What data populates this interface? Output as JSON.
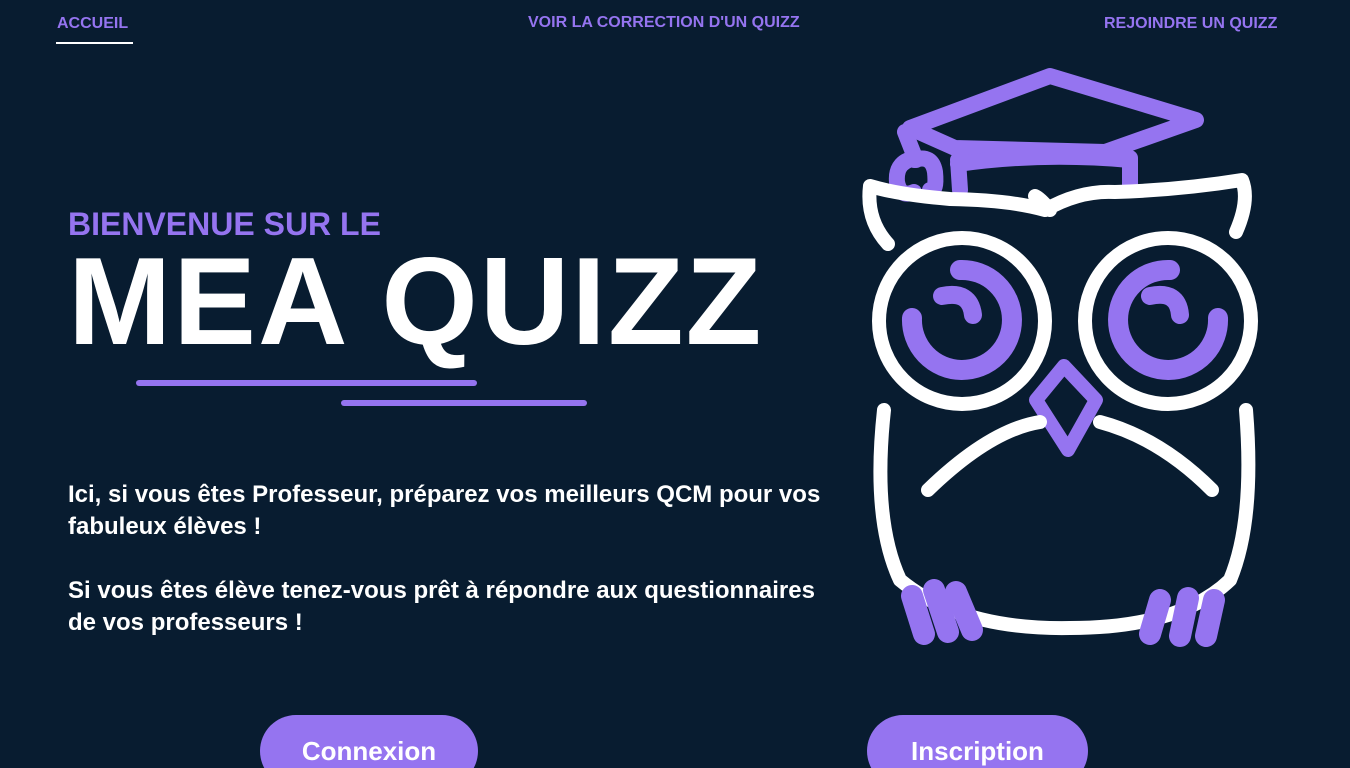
{
  "nav": {
    "home": "ACCUEIL",
    "correction": "VOIR LA CORRECTION D'UN QUIZZ",
    "join": "REJOINDRE UN QUIZZ"
  },
  "hero": {
    "welcome_small": "BIENVENUE SUR LE",
    "title": "MEA QUIZZ",
    "intro_teacher": "Ici, si vous êtes Professeur, préparez vos meilleurs QCM pour vos fabuleux élèves !",
    "intro_student": "Si vous êtes élève tenez-vous prêt à répondre aux questionnaires de vos professeurs !"
  },
  "buttons": {
    "login": "Connexion",
    "signup": "Inscription"
  },
  "illustration": {
    "icon": "graduate-owl-icon"
  },
  "colors": {
    "background": "#081c30",
    "accent": "#9574f0",
    "text": "#ffffff"
  }
}
